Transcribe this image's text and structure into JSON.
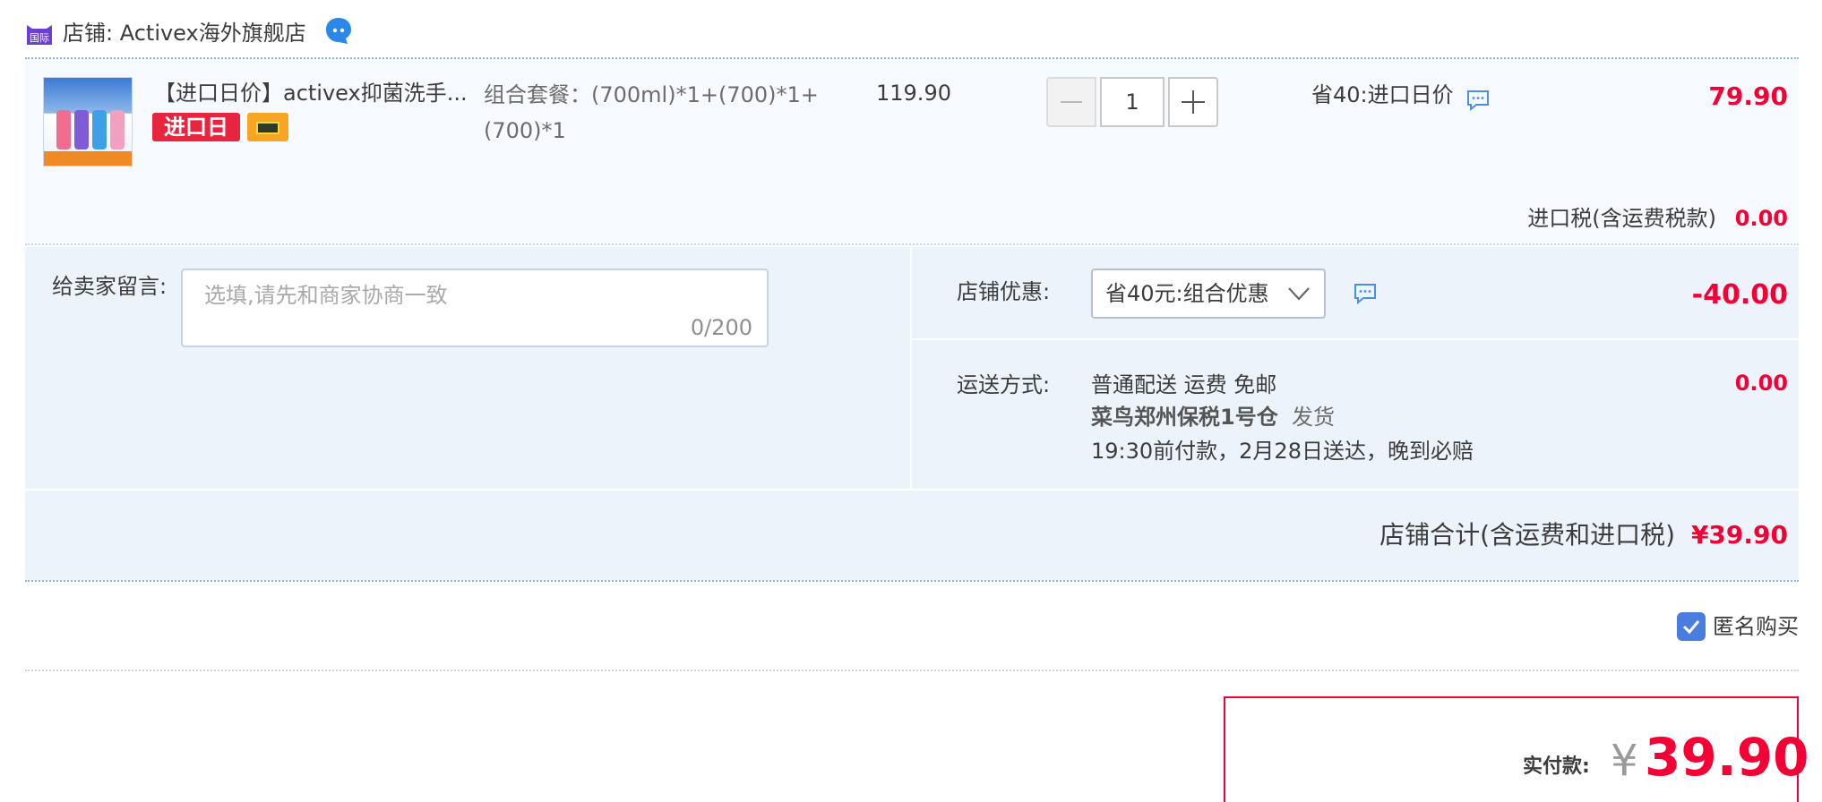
{
  "shop": {
    "badge_text": "国际",
    "name": "店铺: Activex海外旗舰店",
    "chat_icon": "wangwang-chat-icon"
  },
  "item": {
    "title": "【进口日价】activex抑菌洗手...",
    "tag_label": "进口日",
    "sku": "组合套餐：(700ml)*1+(700)*1+(700)*1",
    "unit_price": "119.90",
    "quantity": "1",
    "promo": "省40:进口日价",
    "total": "79.90",
    "tax_label": "进口税(含运费税款)",
    "tax_value": "0.00"
  },
  "message": {
    "label": "给卖家留言:",
    "placeholder": "选填,请先和商家协商一致",
    "count": "0/200"
  },
  "coupon": {
    "label": "店铺优惠:",
    "selected": "省40元:组合优惠",
    "amount": "-40.00"
  },
  "shipping": {
    "label": "运送方式:",
    "method": "普通配送 运费 免邮",
    "warehouse": "菜鸟郑州保税1号仓",
    "dispatch": "发货",
    "promise": "19:30前付款，2月28日送达，晚到必赔",
    "amount": "0.00"
  },
  "shop_total": {
    "label": "店铺合计(含运费和进口税)",
    "value": "¥39.90"
  },
  "anonymous": {
    "label": "匿名购买",
    "checked": true
  },
  "payment": {
    "label": "实付款:",
    "currency": "¥",
    "amount": "39.90"
  },
  "colors": {
    "price_red": "#f40035",
    "panel_bg": "#edf3fb",
    "item_bg": "#f6f9fd",
    "checkbox_blue": "#4a7de0"
  }
}
